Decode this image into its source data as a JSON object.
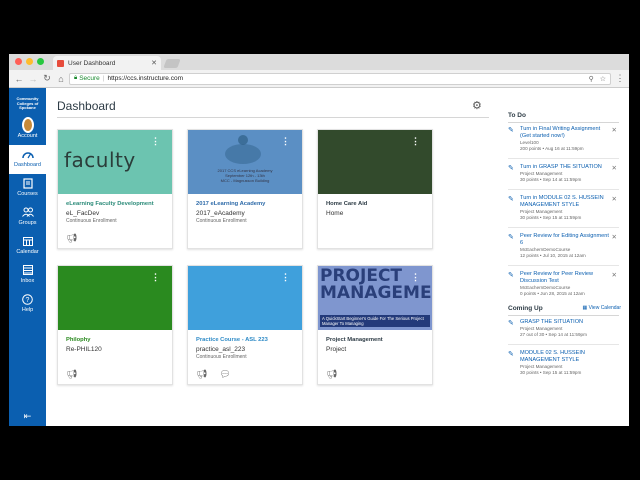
{
  "browser": {
    "tab_title": "User Dashboard",
    "secure_label": "Secure",
    "url": "https://ccs.instructure.com"
  },
  "colors": {
    "brand": "#0b5fb0",
    "dot_red": "#ff5f57",
    "dot_yellow": "#febc2e",
    "dot_green": "#28c840"
  },
  "globalnav": {
    "logo_text": "Community Colleges of Spokane",
    "items": [
      {
        "label": "Account",
        "icon": "avatar-icon"
      },
      {
        "label": "Dashboard",
        "icon": "dashboard-icon",
        "active": true
      },
      {
        "label": "Courses",
        "icon": "book-icon"
      },
      {
        "label": "Groups",
        "icon": "groups-icon"
      },
      {
        "label": "Calendar",
        "icon": "calendar-icon"
      },
      {
        "label": "Inbox",
        "icon": "inbox-icon"
      },
      {
        "label": "Help",
        "icon": "help-icon"
      }
    ]
  },
  "main": {
    "title": "Dashboard",
    "cards": [
      {
        "name": "eLearning Faculty Development",
        "code": "eL_FacDev",
        "term": "Continuous Enrollment",
        "color": "#6cc4b0",
        "name_color": "#2a8a78",
        "hero_text": "faculty"
      },
      {
        "name": "2017 eLearning Academy",
        "code": "2017_eAcademy",
        "term": "Continuous Enrollment",
        "color": "#5b8fc4",
        "name_color": "#2d6aa8",
        "hero_lines": [
          "2017 CCS eLearning Academy",
          "September 12th - 13th",
          "MCC - Magnusson Building"
        ]
      },
      {
        "name": "Home Care Aid",
        "code": "Home",
        "term": "",
        "color": "#324a2c",
        "name_color": "#2d3b45"
      },
      {
        "name": "Philophy",
        "code": "Re-PHIL120",
        "term": "",
        "color": "#2a8a1f",
        "name_color": "#2a8a1f"
      },
      {
        "name": "Practice Course - ASL 223",
        "code": "practice_asl_223",
        "term": "Continuous Enrollment",
        "color": "#3fa0dc",
        "name_color": "#2d8ac6"
      },
      {
        "name": "Project Management",
        "code": "Project",
        "term": "",
        "color": "#5a6fae",
        "name_color": "#2d3b45",
        "hero_title": "PROJECT MANAGEMENT",
        "hero_sub": "A QuickStart Beginner's Guide For The Serious Project Manager To Managing"
      }
    ]
  },
  "sidebar": {
    "todo_heading": "To Do",
    "todos": [
      {
        "title": "Turn in Final Writing Assignment (Get started now!)",
        "sub1": "Level100",
        "sub2": "200 points • Aug 16 at 11:59pm"
      },
      {
        "title": "Turn in GRASP THE SITUATION",
        "sub1": "Project Management",
        "sub2": "30 points • Sep 14 at 11:59pm"
      },
      {
        "title": "Turn in MODULE 02 S. HUSSEIN MANAGEMENT STYLE",
        "sub1": "Project Management",
        "sub2": "30 points • Sep 15 at 11:59pm"
      },
      {
        "title": "Peer Review for Editing Assignment 6",
        "sub1": "McEachernDemoCourse",
        "sub2": "12 points • Jul 10, 2015 at 12am"
      },
      {
        "title": "Peer Review for Peer Review Discussion Test",
        "sub1": "McEachernDemoCourse",
        "sub2": "0 points • Jun 28, 2015 at 12am"
      }
    ],
    "coming_heading": "Coming Up",
    "view_calendar": "View Calendar",
    "coming": [
      {
        "title": "GRASP THE SITUATION",
        "sub1": "Project Management",
        "sub2": "27 out of 30 • Sep 14 at 11:59pm"
      },
      {
        "title": "MODULE 02 S. HUSSEIN MANAGEMENT STYLE",
        "sub1": "Project Management",
        "sub2": "30 points • Sep 15 at 11:59pm"
      }
    ]
  }
}
